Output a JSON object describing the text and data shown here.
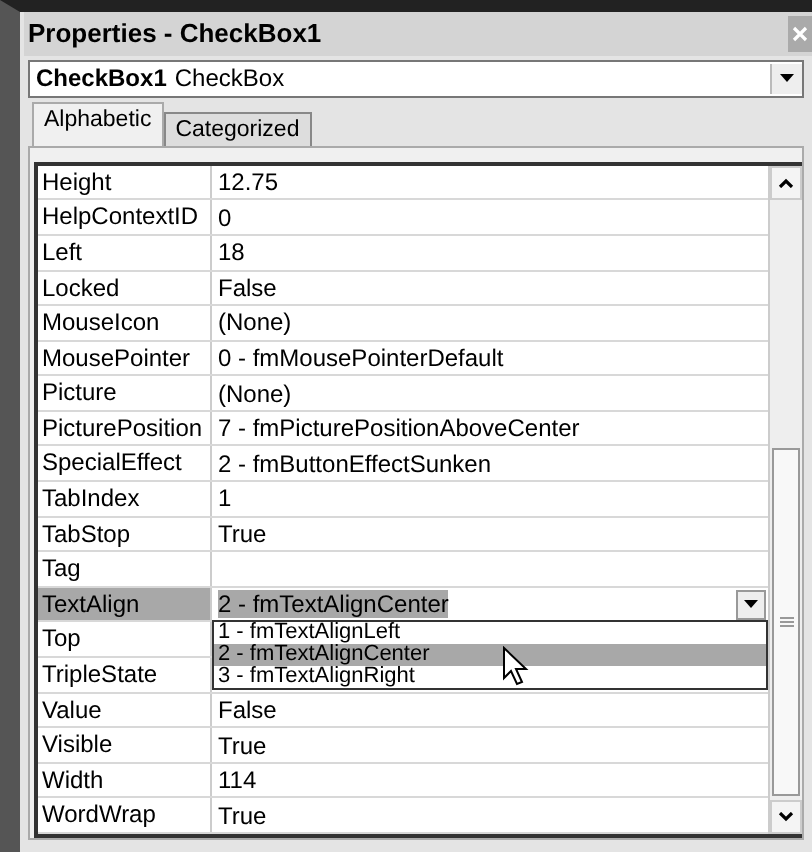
{
  "window": {
    "title": "Properties - CheckBox1"
  },
  "object_selector": {
    "name": "CheckBox1",
    "type": "CheckBox"
  },
  "tabs": [
    {
      "label": "Alphabetic",
      "selected": true
    },
    {
      "label": "Categorized",
      "selected": false
    }
  ],
  "properties": [
    {
      "name": "Height",
      "value": "12.75",
      "selected": false
    },
    {
      "name": "HelpContextID",
      "value": "0",
      "selected": false
    },
    {
      "name": "Left",
      "value": "18",
      "selected": false
    },
    {
      "name": "Locked",
      "value": "False",
      "selected": false
    },
    {
      "name": "MouseIcon",
      "value": "(None)",
      "selected": false
    },
    {
      "name": "MousePointer",
      "value": "0 - fmMousePointerDefault",
      "selected": false
    },
    {
      "name": "Picture",
      "value": "(None)",
      "selected": false
    },
    {
      "name": "PicturePosition",
      "value": "7 - fmPicturePositionAboveCenter",
      "selected": false
    },
    {
      "name": "SpecialEffect",
      "value": "2 - fmButtonEffectSunken",
      "selected": false
    },
    {
      "name": "TabIndex",
      "value": "1",
      "selected": false
    },
    {
      "name": "TabStop",
      "value": "True",
      "selected": false
    },
    {
      "name": "Tag",
      "selected": false
    },
    {
      "name": "TextAlign",
      "value": "2 - fmTextAlignCenter",
      "selected": true,
      "dropdown_options": [
        {
          "label": "1 - fmTextAlignLeft",
          "selected": false
        },
        {
          "label": "2 - fmTextAlignCenter",
          "selected": true
        },
        {
          "label": "3 - fmTextAlignRight",
          "selected": false
        }
      ]
    },
    {
      "name": "Top",
      "selected": false
    },
    {
      "name": "TripleState",
      "selected": false
    },
    {
      "name": "Value",
      "value": "False",
      "selected": false
    },
    {
      "name": "Visible",
      "value": "True",
      "selected": false
    },
    {
      "name": "Width",
      "value": "114",
      "selected": false
    },
    {
      "name": "WordWrap",
      "value": "True",
      "selected": false
    }
  ]
}
